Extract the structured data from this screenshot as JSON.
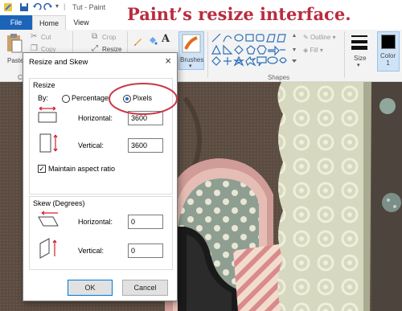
{
  "window": {
    "title": "Tut - Paint"
  },
  "tabs": {
    "file": "File",
    "home": "Home",
    "view": "View"
  },
  "ribbon": {
    "clipboard": {
      "paste": "Paste",
      "cut": "Cut",
      "copy": "Copy",
      "group_label": "C"
    },
    "image": {
      "crop": "Crop",
      "resize": "Resize"
    },
    "tools": {
      "text_icon": "A"
    },
    "brushes": "Brushes",
    "shapes": {
      "outline": "Outline",
      "fill": "Fill",
      "group_label": "Shapes"
    },
    "size": "Size",
    "color1": "Color\n1"
  },
  "dialog": {
    "title": "Resize and Skew",
    "close": "×",
    "resize": {
      "title": "Resize",
      "by": "By:",
      "percentage": "Percentage",
      "pixels": "Pixels",
      "selected": "pixels",
      "horizontal_label": "Horizontal:",
      "horizontal_value": "3600",
      "vertical_label": "Vertical:",
      "vertical_value": "3600",
      "maintain_aspect": "Maintain aspect ratio",
      "maintain_checked": true
    },
    "skew": {
      "title": "Skew (Degrees)",
      "horizontal_label": "Horizontal:",
      "horizontal_value": "0",
      "vertical_label": "Vertical:",
      "vertical_value": "0"
    },
    "ok": "OK",
    "cancel": "Cancel"
  },
  "annotation": "Paint’s resize interface.",
  "colors": {
    "accent": "#1c64b8",
    "annotation": "#b92b3e",
    "highlight_ring": "#c8394a"
  }
}
